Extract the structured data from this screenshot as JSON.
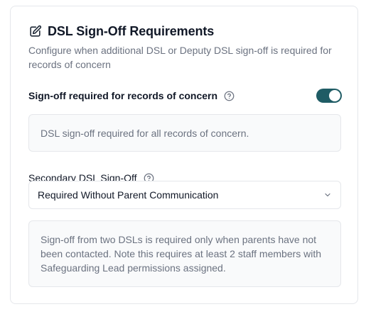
{
  "card": {
    "title": "DSL Sign-Off Requirements",
    "subtitle": "Configure when additional DSL or Deputy DSL sign-off is required for records of concern"
  },
  "sign_off_required": {
    "label": "Sign-off required for records of concern",
    "help_icon": "question-circle-icon",
    "toggle_on": true,
    "info": "DSL sign-off required for all records of concern."
  },
  "secondary": {
    "label": "Secondary DSL Sign-Off",
    "help_icon": "question-circle-icon",
    "selected": "Required Without Parent Communication",
    "info": "Sign-off from two DSLs is required only when parents have not been contacted. Note this requires at least 2 staff members with Safeguarding Lead permissions assigned."
  },
  "colors": {
    "accent": "#1f5c65",
    "muted_text": "#6b7280",
    "border": "#e5e7eb",
    "info_bg": "#f9fafb"
  }
}
